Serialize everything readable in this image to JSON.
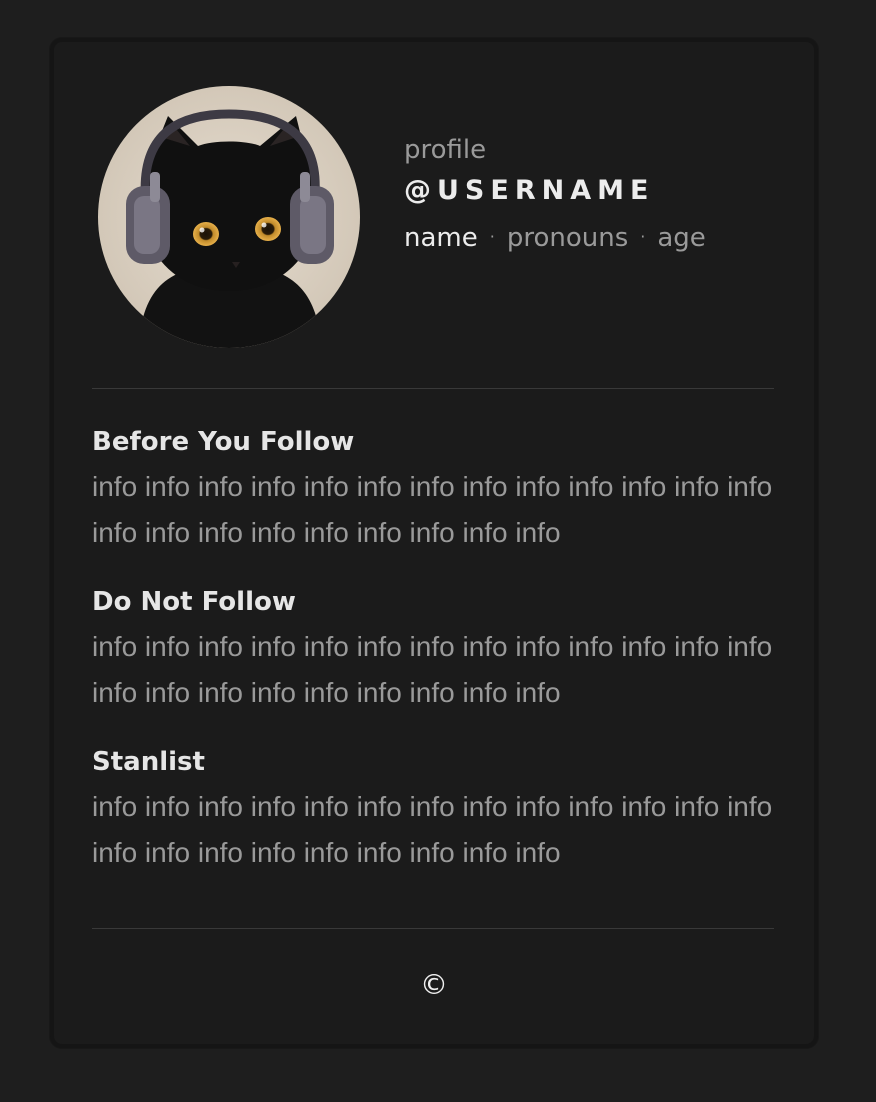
{
  "profile": {
    "label": "profile",
    "username": "@USERNAME",
    "name": "name",
    "pronouns": "pronouns",
    "age": "age",
    "separator": "·",
    "avatar_icon": "black-cat-with-headphones"
  },
  "sections": [
    {
      "title": "Before You Follow",
      "body": "info info info info info info info info info info info info info info info info info info info info info info"
    },
    {
      "title": "Do Not Follow",
      "body": "info info info info info info info info info info info info info info info info info info info info info info"
    },
    {
      "title": "Stanlist",
      "body": "info info info info info info info info info info info info info info info info info info info info info info"
    }
  ],
  "footer": {
    "copyright": "©"
  },
  "colors": {
    "page_bg": "#1e1e1e",
    "card_bg": "#1b1b1b",
    "text_primary": "#ececec",
    "text_muted": "#9a9a9a",
    "divider": "#393939"
  }
}
